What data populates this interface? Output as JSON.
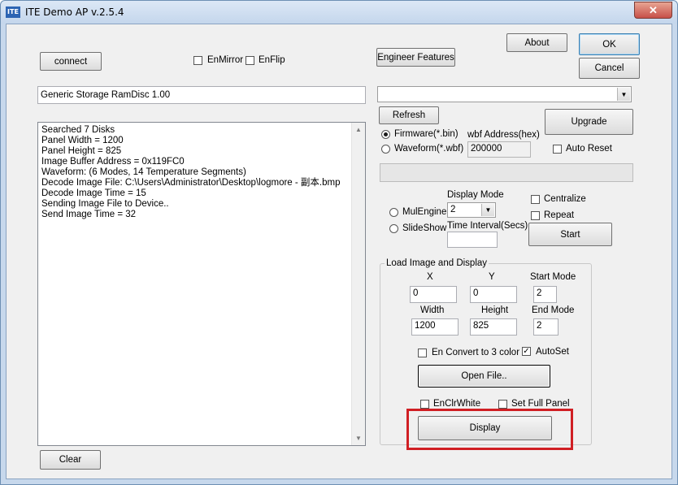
{
  "window": {
    "title": "ITE Demo AP v.2.5.4",
    "icon_text": "ITE",
    "close_glyph": "✕"
  },
  "buttons": {
    "connect": "connect",
    "engineer": "Engineer Features",
    "about": "About",
    "ok": "OK",
    "cancel": "Cancel",
    "refresh": "Refresh",
    "upgrade": "Upgrade",
    "start": "Start",
    "open_file": "Open File..",
    "display": "Display",
    "clear": "Clear"
  },
  "checkboxes": {
    "en_mirror": {
      "label": "EnMirror",
      "checked": false
    },
    "en_flip": {
      "label": "EnFlip",
      "checked": false
    },
    "auto_reset": {
      "label": "Auto Reset",
      "checked": false
    },
    "centralize": {
      "label": "Centralize",
      "checked": false
    },
    "repeat": {
      "label": "Repeat",
      "checked": false
    },
    "en_convert": {
      "label": "En Convert to 3 color",
      "checked": false
    },
    "autoset": {
      "label": "AutoSet",
      "checked": true
    },
    "en_clr_white": {
      "label": "EnClrWhite",
      "checked": false
    },
    "set_full_panel": {
      "label": "Set Full Panel",
      "checked": false
    }
  },
  "device_field": "Generic Storage RamDisc 1.00",
  "log": {
    "lines": [
      "Searched 7 Disks",
      "Panel Width = 1200",
      "Panel Height = 825",
      "Image Buffer Address = 0x119FC0",
      "Waveform: (6 Modes, 14 Temperature Segments)",
      "Decode Image File: C:\\Users\\Administrator\\Desktop\\logmore - 副本.bmp",
      "Decode Image Time = 15",
      "Sending Image File to Device..",
      "Send Image Time = 32"
    ]
  },
  "upgrade": {
    "radio_firmware": "Firmware(*.bin)",
    "radio_waveform": "Waveform(*.wbf)",
    "wbf_address_label": "wbf Address(hex)",
    "wbf_address_value": "200000"
  },
  "engine": {
    "mul_engine": "MulEngine",
    "slide_show": "SlideShow",
    "display_mode_label": "Display Mode",
    "display_mode_value": "2",
    "time_interval_label": "Time Interval(Secs)",
    "time_interval_value": ""
  },
  "load_group": {
    "title": "Load Image and Display",
    "x_label": "X",
    "x_value": "0",
    "y_label": "Y",
    "y_value": "0",
    "start_mode_label": "Start Mode",
    "start_mode_value": "2",
    "width_label": "Width",
    "width_value": "1200",
    "height_label": "Height",
    "height_value": "825",
    "end_mode_label": "End Mode",
    "end_mode_value": "2"
  },
  "glyphs": {
    "check": "✓",
    "dropdown": "▼",
    "scroll_up": "▲",
    "scroll_down": "▼"
  },
  "colors": {
    "highlight": "#d01f24",
    "titlebar": "#c4d6ec"
  }
}
